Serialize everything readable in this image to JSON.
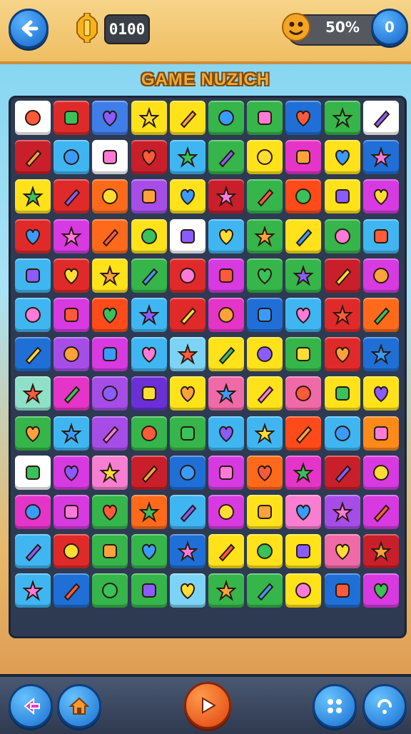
{
  "header": {
    "coins": "0100",
    "progress_text": "50%",
    "progress_btn": "0",
    "icons": [
      "back-arrow-icon",
      "coin-icon",
      "mascot-icon"
    ]
  },
  "title": "GAME NUZICH",
  "board": {
    "rows": 13,
    "cols": 10,
    "tiles": [
      [
        "#ffffff",
        "#e02a2a",
        "#3f7de8",
        "#ffe21a",
        "#ffe21a",
        "#35b54a",
        "#35b54a",
        "#1f6fd6",
        "#35b54a",
        "#ffffff"
      ],
      [
        "#c91f2a",
        "#3fb6f2",
        "#ffffff",
        "#c91f2a",
        "#3fb6f2",
        "#35b54a",
        "#ffe21a",
        "#e534c8",
        "#ffe21a",
        "#1f6fd6"
      ],
      [
        "#ffe21a",
        "#e02a2a",
        "#ff6a1a",
        "#a64de8",
        "#ffe21a",
        "#c91f2a",
        "#35b54a",
        "#ff4a1a",
        "#ffe21a",
        "#d63ae0"
      ],
      [
        "#e02a2a",
        "#d63ae0",
        "#ff6a1a",
        "#ffe21a",
        "#ffffff",
        "#3fb6f2",
        "#35b54a",
        "#ffe21a",
        "#35b54a",
        "#3fb6f2"
      ],
      [
        "#3fb6f2",
        "#e02a2a",
        "#ffe21a",
        "#35b54a",
        "#e02a2a",
        "#d63ae0",
        "#35b54a",
        "#35b54a",
        "#c91f2a",
        "#d63ae0"
      ],
      [
        "#3fb6f2",
        "#d63ae0",
        "#ff4a1a",
        "#3fb6f2",
        "#e02a2a",
        "#e534c8",
        "#1f6fd6",
        "#3fb6f2",
        "#e02a2a",
        "#ff6a1a"
      ],
      [
        "#1f6fd6",
        "#a64de8",
        "#d63ae0",
        "#3fb6f2",
        "#7dd3f5",
        "#ffe21a",
        "#ffe21a",
        "#35b54a",
        "#e02a2a",
        "#1f6fd6"
      ],
      [
        "#8fe0c8",
        "#e534c8",
        "#a64de8",
        "#6a2fd6",
        "#ffe21a",
        "#f06aa8",
        "#ffe21a",
        "#f06aa8",
        "#ffe21a",
        "#ffe21a"
      ],
      [
        "#35b54a",
        "#3fb6f2",
        "#a64de8",
        "#35b54a",
        "#35b54a",
        "#3fb6f2",
        "#3fb6f2",
        "#ff4a1a",
        "#3fb6f2",
        "#ff8a1a"
      ],
      [
        "#ffffff",
        "#d63ae0",
        "#f77ed0",
        "#c91f2a",
        "#1f6fd6",
        "#d63ae0",
        "#ff6a1a",
        "#e534c8",
        "#c91f2a",
        "#d63ae0"
      ],
      [
        "#e534c8",
        "#d63ae0",
        "#35b54a",
        "#ff6a1a",
        "#3fb6f2",
        "#d63ae0",
        "#ffe21a",
        "#f77ed0",
        "#a64de8",
        "#d63ae0"
      ],
      [
        "#3fb6f2",
        "#e02a2a",
        "#35b54a",
        "#35b54a",
        "#1f6fd6",
        "#ffe21a",
        "#ffe21a",
        "#ffe21a",
        "#f06aa8",
        "#c91f2a"
      ],
      [
        "#3fb6f2",
        "#1f6fd6",
        "#35b54a",
        "#35b54a",
        "#7dd3f5",
        "#35b54a",
        "#35b54a",
        "#ffe21a",
        "#1f6fd6",
        "#d63ae0"
      ]
    ]
  },
  "bottom_bar": {
    "buttons": [
      "move-left-icon",
      "home-icon",
      "play-icon",
      "shuffle-icon",
      "hint-icon"
    ]
  }
}
